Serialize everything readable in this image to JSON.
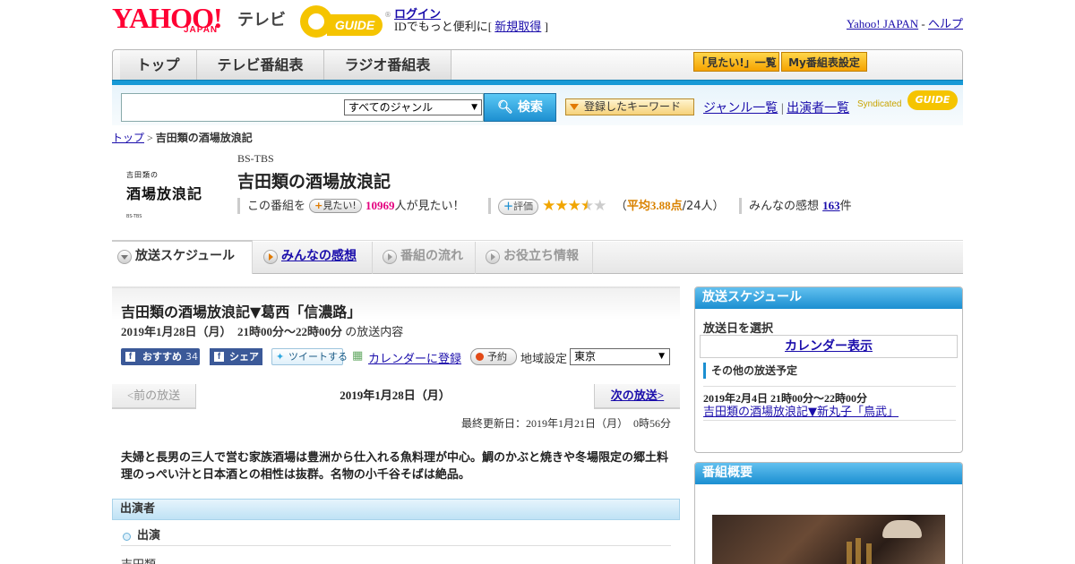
{
  "header": {
    "yahoo_logo": "YAHOO!",
    "japan_label": "JAPAN",
    "tv_label": "テレビ",
    "gguide_logo": "GUIDE",
    "login": "ログイン",
    "login_text_prefix": "IDでもっと便利に[ ",
    "register": "新規取得",
    "login_text_suffix": " ]",
    "yahoo_japan_link": "Yahoo! JAPAN",
    "separator": " - ",
    "help_link": "ヘルプ"
  },
  "nav": {
    "tabs": [
      "トップ",
      "テレビ番組表",
      "ラジオ番組表"
    ],
    "watch_list": "「見たい!」一覧",
    "my_schedule": "My番組表設定"
  },
  "search": {
    "genre": "すべてのジャンル",
    "button": "検索",
    "keyword_button": "登録したキーワード",
    "genre_list": "ジャンル一覧",
    "link_separator": " | ",
    "performer_list": "出演者一覧",
    "syndicated": "Syndicated"
  },
  "breadcrumb": {
    "top": "トップ",
    "separator": " > ",
    "current": "吉田類の酒場放浪記"
  },
  "program": {
    "logo_line1": "吉田類の",
    "logo_line2": "酒場放浪記",
    "logo_line3": "BS-TBS",
    "channel": "BS-TBS",
    "title": "吉田類の酒場放浪記",
    "watch_prefix": "この番組を",
    "watch_button": "見たい!",
    "watch_count": "10969",
    "watch_suffix": "人が見たい！",
    "rating_button": "評価",
    "rating": 3.88,
    "rating_open": "（",
    "rating_avg": "平均3.88点",
    "rating_count": "/24人）",
    "comments_label": "みんなの感想",
    "comments_count": "163",
    "comments_suffix": "件"
  },
  "subtabs": [
    "放送スケジュール",
    "みんなの感想",
    "番組の流れ",
    "お役立ち情報"
  ],
  "episode": {
    "title": "吉田類の酒場放浪記▼葛西「信濃路」",
    "date": "2019年1月28日（月）　21時00分～22時00分",
    "date_suffix": "の放送内容",
    "fb_recommend": "おすすめ",
    "fb_count": "34",
    "fb_share": "シェア",
    "tweet": "ツイートする",
    "calendar": "カレンダーに登録",
    "reserve": "予約",
    "region_label": "地域設定",
    "region": "東京"
  },
  "pager": {
    "prev": "<前の放送",
    "current": "2019年1月28日（月）",
    "next": "次の放送>"
  },
  "updated": "最終更新日：2019年1月21日（月）　0時56分",
  "description": "夫婦と長男の三人で営む家族酒場は豊洲から仕入れる魚料理が中心。鯛のかぶと焼きや冬場限定の郷土料理のっぺい汁と日本酒との相性は抜群。名物の小千谷そばは絶品。",
  "cast": {
    "heading": "出演者",
    "sub_heading": "出演",
    "name": "吉田類"
  },
  "sidebar": {
    "schedule_title": "放送スケジュール",
    "select_date": "放送日を選択",
    "calendar_button": "カレンダー表示",
    "other_schedule": "その他の放送予定",
    "other_date": "2019年2月4日  21時00分～22時00分",
    "other_link": "吉田類の酒場放浪記▼新丸子「鳥武」",
    "overview_title": "番組概要"
  }
}
